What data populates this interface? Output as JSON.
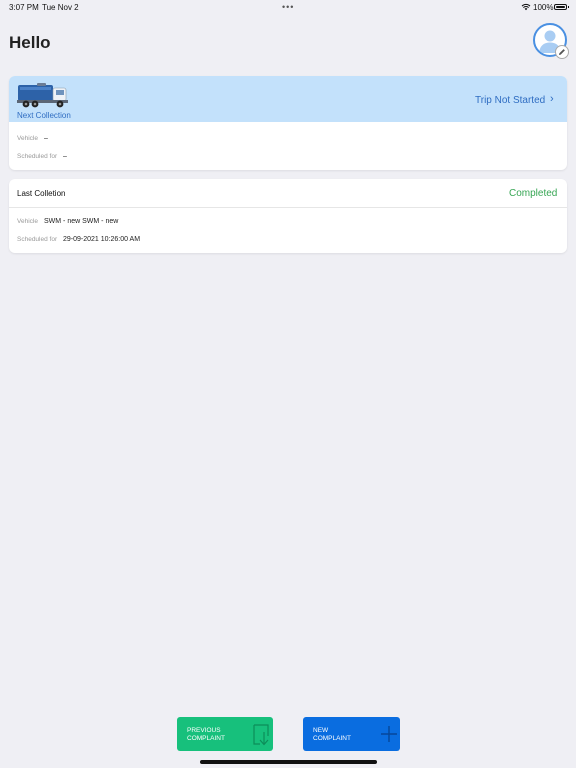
{
  "status_bar": {
    "time": "3:07 PM",
    "date": "Tue Nov 2",
    "dots": "•••",
    "battery_percent": "100%"
  },
  "header": {
    "greeting": "Hello"
  },
  "next_collection": {
    "label": "Next Collection",
    "trip_status": "Trip Not Started",
    "chevron": "›",
    "vehicle_label": "Vehicle",
    "vehicle_value": "–",
    "scheduled_label": "Scheduled for",
    "scheduled_value": "–"
  },
  "last_collection": {
    "title": "Last Colletion",
    "status": "Completed",
    "vehicle_label": "Vehicle",
    "vehicle_value": "SWM - new SWM - new",
    "scheduled_label": "Scheduled for",
    "scheduled_value": "29-09-2021 10:26:00 AM"
  },
  "buttons": {
    "previous_complaint": "PREVIOUS\nCOMPLAINT",
    "new_complaint": "NEW\nCOMPLAINT"
  },
  "colors": {
    "banner": "#c3e1fb",
    "accent_blue": "#2f6dc2",
    "completed_green": "#37a654",
    "prev_button": "#17c07c",
    "new_button": "#0a6de0"
  },
  "icons": {
    "wifi": "wifi-icon",
    "battery": "battery-icon",
    "avatar": "user-avatar-icon",
    "edit": "pencil-icon",
    "truck": "garbage-truck-icon",
    "chevron": "chevron-right-icon",
    "download": "download-icon",
    "plus": "plus-icon"
  }
}
